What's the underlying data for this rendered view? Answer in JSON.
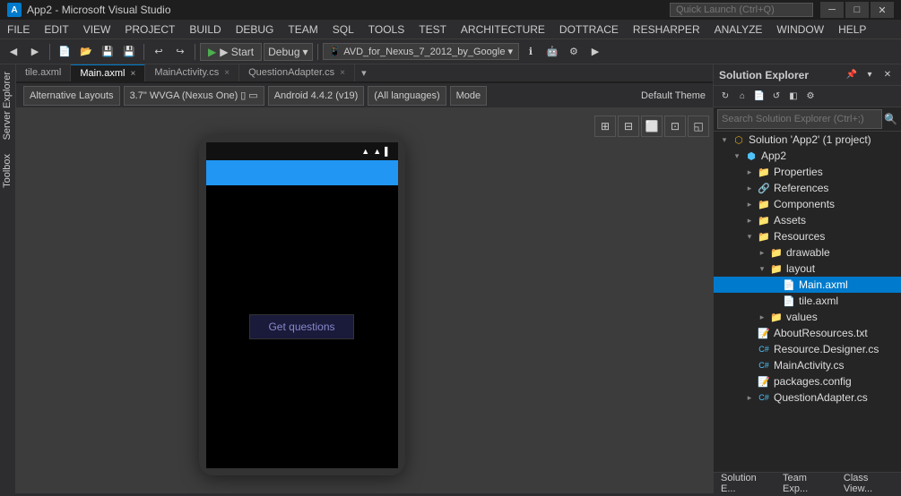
{
  "app": {
    "title": "App2 - Microsoft Visual Studio",
    "vs_logo": "A"
  },
  "title_bar": {
    "title": "App2 - Microsoft Visual Studio",
    "search_placeholder": "Quick Launch (Ctrl+Q)",
    "min_btn": "─",
    "max_btn": "□",
    "close_btn": "✕"
  },
  "menu": {
    "items": [
      "FILE",
      "EDIT",
      "VIEW",
      "PROJECT",
      "BUILD",
      "DEBUG",
      "TEAM",
      "SQL",
      "TOOLS",
      "TEST",
      "ARCHITECTURE",
      "DOTTRACE",
      "RESHARPER",
      "ANALYZE",
      "WINDOW",
      "HELP"
    ]
  },
  "toolbar": {
    "run_label": "▶  Start",
    "debug_label": "Debug",
    "avd_label": "AVD_for_Nexus_7_2012_by_Google"
  },
  "tabs": [
    {
      "label": "tile.axml",
      "active": false,
      "closable": false
    },
    {
      "label": "Main.axml",
      "active": false,
      "closable": true
    },
    {
      "label": "MainActivity.cs",
      "active": false,
      "closable": true
    },
    {
      "label": "QuestionAdapter.cs",
      "active": false,
      "closable": true
    }
  ],
  "design_toolbar": {
    "alt_layouts": "Alternative Layouts",
    "screen_size": "3.7\" WVGA (Nexus One)",
    "android_version": "Android 4.4.2 (v19)",
    "language": "(All languages)",
    "mode": "Mode",
    "theme": "Default Theme"
  },
  "device": {
    "status_icons": "▲ ▌▌",
    "btn_label": "Get questions"
  },
  "solution_explorer": {
    "title": "Solution Explorer",
    "search_placeholder": "Search Solution Explorer (Ctrl+;)",
    "solution_label": "Solution 'App2' (1 project)",
    "project_label": "App2",
    "tree_items": [
      {
        "label": "Solution 'App2' (1 project)",
        "level": 0,
        "expanded": true,
        "icon": "solution",
        "has_arrow": true
      },
      {
        "label": "App2",
        "level": 1,
        "expanded": true,
        "icon": "project",
        "has_arrow": true
      },
      {
        "label": "Properties",
        "level": 2,
        "expanded": false,
        "icon": "folder",
        "has_arrow": true
      },
      {
        "label": "References",
        "level": 2,
        "expanded": false,
        "icon": "ref",
        "has_arrow": true
      },
      {
        "label": "Components",
        "level": 2,
        "expanded": false,
        "icon": "folder",
        "has_arrow": true
      },
      {
        "label": "Assets",
        "level": 2,
        "expanded": false,
        "icon": "folder",
        "has_arrow": true
      },
      {
        "label": "Resources",
        "level": 2,
        "expanded": true,
        "icon": "folder",
        "has_arrow": true
      },
      {
        "label": "drawable",
        "level": 3,
        "expanded": false,
        "icon": "folder",
        "has_arrow": true
      },
      {
        "label": "layout",
        "level": 3,
        "expanded": true,
        "icon": "folder",
        "has_arrow": true
      },
      {
        "label": "Main.axml",
        "level": 4,
        "expanded": false,
        "icon": "file",
        "has_arrow": false,
        "selected": true
      },
      {
        "label": "tile.axml",
        "level": 4,
        "expanded": false,
        "icon": "file",
        "has_arrow": false
      },
      {
        "label": "values",
        "level": 3,
        "expanded": false,
        "icon": "folder",
        "has_arrow": true
      },
      {
        "label": "AboutResources.txt",
        "level": 2,
        "expanded": false,
        "icon": "txt",
        "has_arrow": false
      },
      {
        "label": "Resource.Designer.cs",
        "level": 2,
        "expanded": false,
        "icon": "cs",
        "has_arrow": false
      },
      {
        "label": "MainActivity.cs",
        "level": 2,
        "expanded": false,
        "icon": "cs",
        "has_arrow": false
      },
      {
        "label": "packages.config",
        "level": 2,
        "expanded": false,
        "icon": "txt",
        "has_arrow": false
      },
      {
        "label": "QuestionAdapter.cs",
        "level": 2,
        "expanded": false,
        "icon": "cs",
        "has_arrow": true
      }
    ],
    "footer_tabs": [
      "Solution E...",
      "Team Exp...",
      "Class View..."
    ]
  },
  "sidebar_labels": [
    "Server Explorer",
    "Toolbox"
  ],
  "status_bar": {
    "text": ""
  }
}
